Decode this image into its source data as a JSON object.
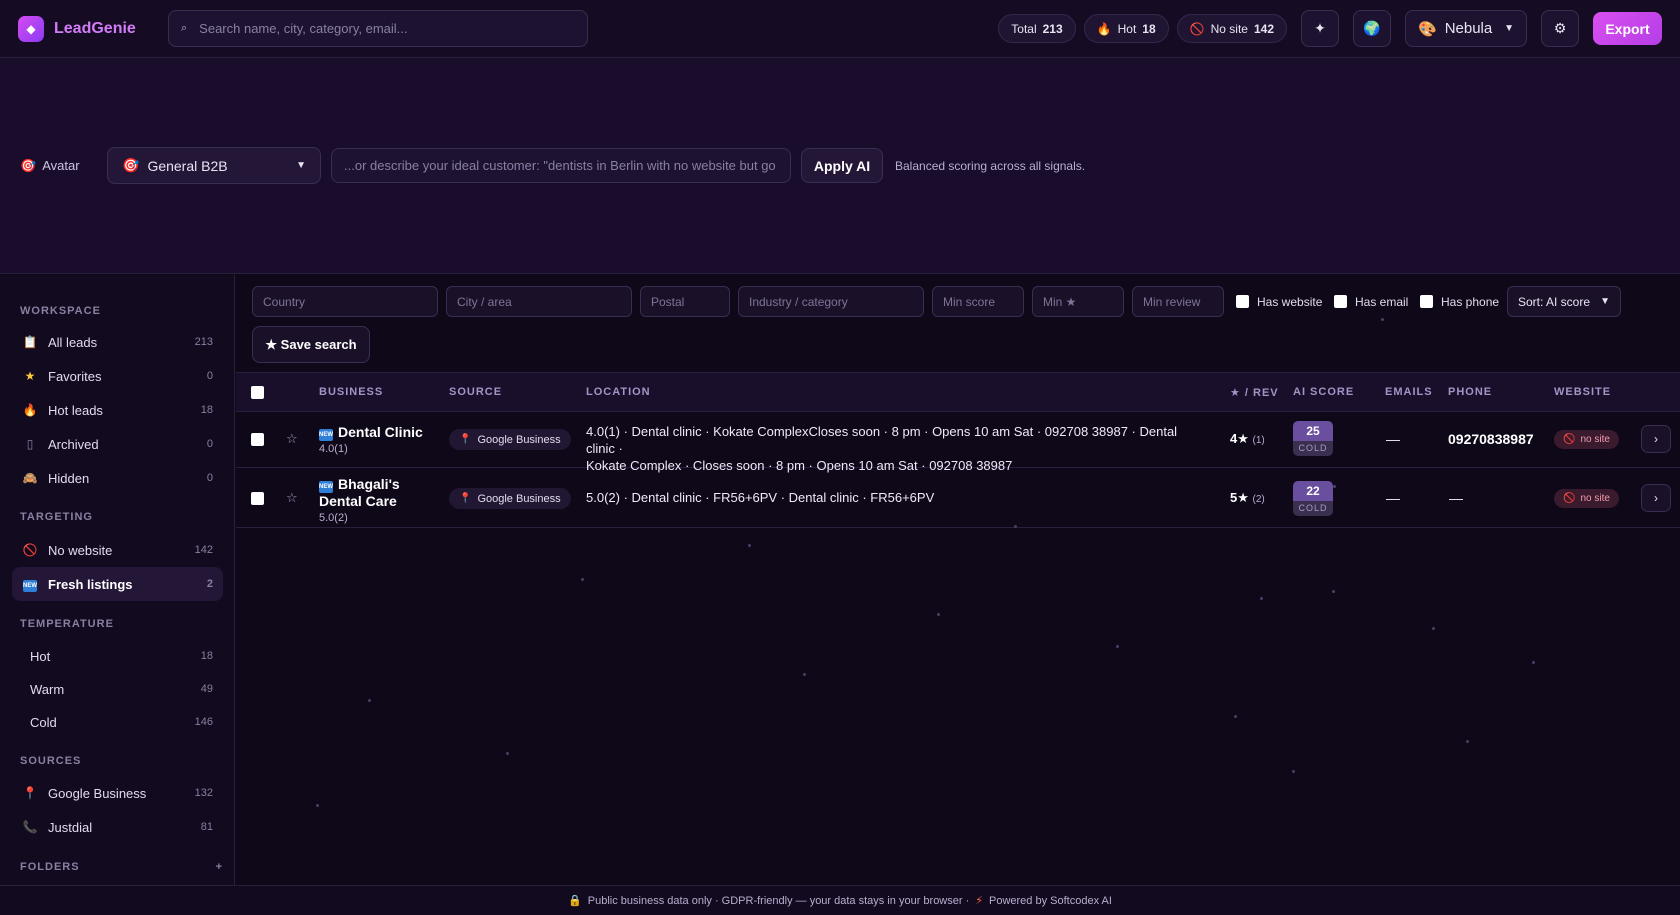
{
  "app": {
    "name": "LeadGenie"
  },
  "search": {
    "placeholder": "Search name, city, category, email..."
  },
  "stats": {
    "total_label": "Total",
    "total_value": "213",
    "hot_label": "Hot",
    "hot_value": "18",
    "nosite_label": "No site",
    "nosite_value": "142"
  },
  "theme": {
    "selected": "Nebula"
  },
  "export_label": "Export",
  "ai": {
    "avatar_label": "Avatar",
    "avatar_selected": "General B2B",
    "placeholder": "...or describe your ideal customer: \"dentists in Berlin with no website but go",
    "apply_label": "Apply AI",
    "hint": "Balanced scoring across all signals."
  },
  "sidebar": {
    "workspace_heading": "WORKSPACE",
    "workspace": [
      {
        "label": "All leads",
        "count": "213"
      },
      {
        "label": "Favorites",
        "count": "0"
      },
      {
        "label": "Hot leads",
        "count": "18"
      },
      {
        "label": "Archived",
        "count": "0"
      },
      {
        "label": "Hidden",
        "count": "0"
      }
    ],
    "targeting_heading": "TARGETING",
    "targeting": [
      {
        "label": "No website",
        "count": "142"
      },
      {
        "label": "Fresh listings",
        "count": "2"
      }
    ],
    "temperature_heading": "TEMPERATURE",
    "temperature": [
      {
        "label": "Hot",
        "count": "18"
      },
      {
        "label": "Warm",
        "count": "49"
      },
      {
        "label": "Cold",
        "count": "146"
      }
    ],
    "sources_heading": "SOURCES",
    "sources": [
      {
        "label": "Google Business",
        "count": "132"
      },
      {
        "label": "Justdial",
        "count": "81"
      }
    ],
    "folders_heading": "FOLDERS",
    "folders_add": "+"
  },
  "filters": {
    "country": "Country",
    "city": "City / area",
    "postal": "Postal",
    "industry": "Industry / category",
    "min_score": "Min score",
    "min_star": "Min ★",
    "min_review": "Min review",
    "has_website": "Has website",
    "has_email": "Has email",
    "has_phone": "Has phone",
    "sort": "Sort: AI score",
    "save_search": "★ Save search"
  },
  "table": {
    "headers": {
      "business": "BUSINESS",
      "source": "SOURCE",
      "location": "LOCATION",
      "rev": "★ / REV",
      "score": "AI SCORE",
      "emails": "EMAILS",
      "phone": "PHONE",
      "website": "WEBSITE"
    },
    "rows": [
      {
        "name": "Dental Clinic",
        "sub": "4.0(1)",
        "source": "Google Business",
        "location_1": "4.0(1) · Dental clinic · Kokate ComplexCloses soon · 8 pm · Opens 10 am Sat · 092708 38987 · Dental clinic ·",
        "location_2": "Kokate Complex · Closes soon · 8 pm · Opens 10 am Sat · 092708 38987",
        "rating": "4★",
        "reviews": "(1)",
        "score": "25",
        "score_label": "COLD",
        "emails": "—",
        "phone": "09270838987",
        "website": "no site"
      },
      {
        "name_1": "Bhagali's",
        "name_2": "Dental Care",
        "sub": "5.0(2)",
        "source": "Google Business",
        "location_1": "5.0(2) · Dental clinic · FR56+6PV · Dental clinic · FR56+6PV",
        "rating": "5★",
        "reviews": "(2)",
        "score": "22",
        "score_label": "COLD",
        "emails": "—",
        "phone": "—",
        "website": "no site"
      }
    ]
  },
  "footer": {
    "text": "Public business data only · GDPR-friendly — your data stays in your browser ·",
    "powered": "Powered by Softcodex AI"
  },
  "colors": {
    "accent": "#d54cf0",
    "background": "#0e0818",
    "score_badge": "#6a4fa0"
  }
}
